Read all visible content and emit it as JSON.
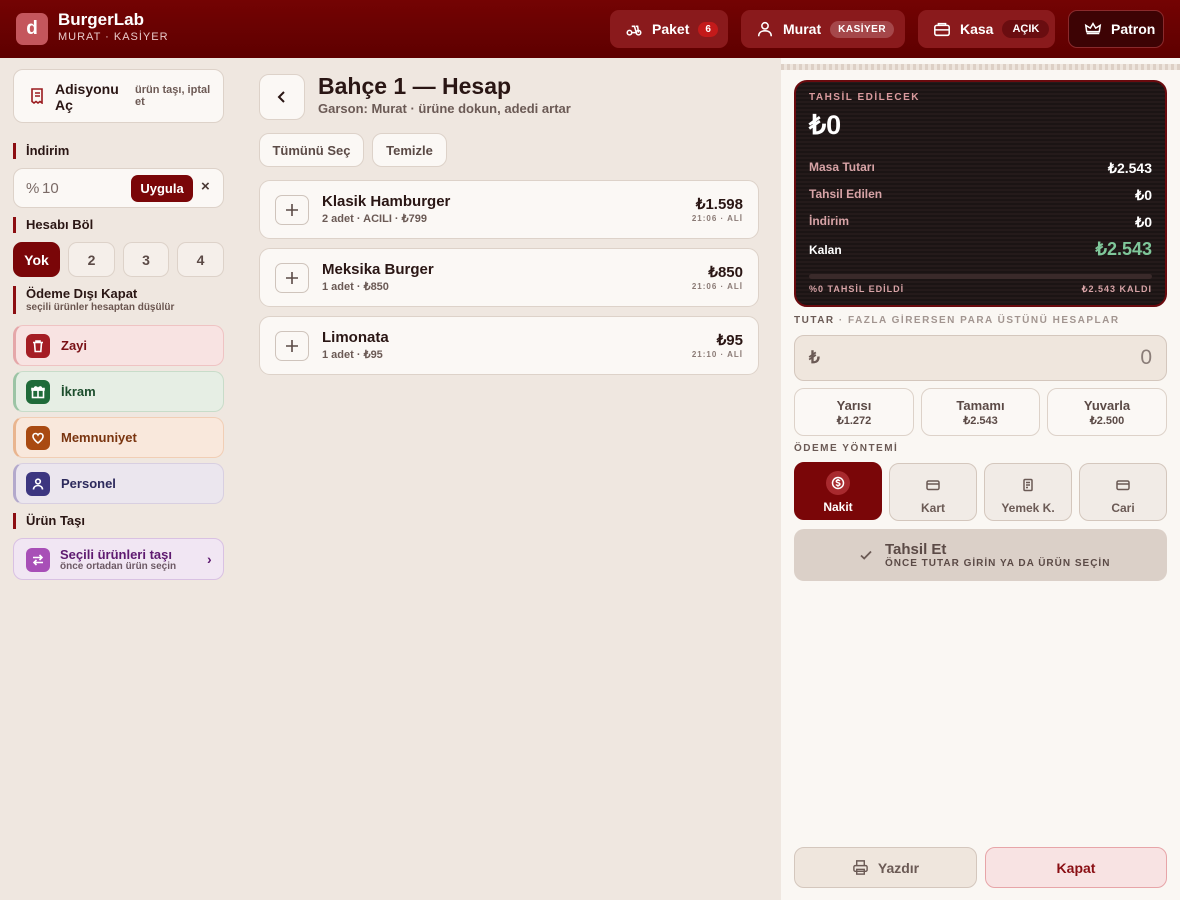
{
  "header": {
    "logo_letter": "d",
    "brand": "BurgerLab",
    "subtitle": "MURAT · KASİYER",
    "paket": {
      "label": "Paket",
      "count": "6"
    },
    "user": {
      "label": "Murat",
      "role": "KASİYER"
    },
    "kasa": {
      "label": "Kasa",
      "status": "AÇIK"
    },
    "patron": {
      "label": "Patron"
    }
  },
  "left": {
    "adisyon": {
      "label": "Adisyonu Aç",
      "sub": "ürün taşı, iptal et"
    },
    "discount": {
      "title": "İndirim",
      "prefix": "%",
      "value": "10",
      "apply": "Uygula",
      "clear": "×"
    },
    "split": {
      "title": "Hesabı Böl",
      "options": [
        "Yok",
        "2",
        "3",
        "4"
      ]
    },
    "off_payment": {
      "title": "Ödeme Dışı Kapat",
      "sub": "seçili ürünler hesaptan düşülür",
      "items": [
        {
          "label": "Zayi",
          "icon": "trash-icon"
        },
        {
          "label": "İkram",
          "icon": "gift-icon"
        },
        {
          "label": "Memnuniyet",
          "icon": "heart-icon"
        },
        {
          "label": "Personel",
          "icon": "person-icon"
        }
      ]
    },
    "move": {
      "title": "Ürün Taşı",
      "label": "Seçili ürünleri taşı",
      "sub": "önce ortadan ürün seçin",
      "chevron": "›"
    }
  },
  "main": {
    "title": "Bahçe 1 — Hesap",
    "subtitle": "Garson: Murat · ürüne dokun, adedi artar",
    "select_all": "Tümünü Seç",
    "clear": "Temizle",
    "items": [
      {
        "name": "Klasik Hamburger",
        "detail": "2 adet · ACILI · ₺799",
        "price": "₺1.598",
        "time": "21:06 · ALİ"
      },
      {
        "name": "Meksika Burger",
        "detail": "1 adet · ₺850",
        "price": "₺850",
        "time": "21:06 · ALİ"
      },
      {
        "name": "Limonata",
        "detail": "1 adet · ₺95",
        "price": "₺95",
        "time": "21:10 · ALİ"
      }
    ]
  },
  "right": {
    "card": {
      "label": "TAHSİL EDİLECEK",
      "amount": "₺0",
      "rows": [
        {
          "k": "Masa Tutarı",
          "v": "₺2.543"
        },
        {
          "k": "Tahsil Edilen",
          "v": "₺0"
        },
        {
          "k": "İndirim",
          "v": "₺0"
        },
        {
          "k": "Kalan",
          "v": "₺2.543"
        }
      ],
      "progress_fraction": 0,
      "footer_left": "%0 TAHSİL EDİLDİ",
      "footer_right": "₺2.543 KALDI"
    },
    "amount_caption": "TUTAR",
    "amount_hint": "· FAZLA GİRERSEN PARA ÜSTÜNÜ HESAPLAR",
    "amount_symbol": "₺",
    "amount_value": "0",
    "quick": [
      {
        "label": "Yarısı",
        "value": "₺1.272"
      },
      {
        "label": "Tamamı",
        "value": "₺2.543"
      },
      {
        "label": "Yuvarla",
        "value": "₺2.500"
      }
    ],
    "method_caption": "ÖDEME YÖNTEMİ",
    "methods": [
      "Nakit",
      "Kart",
      "Yemek K.",
      "Cari"
    ],
    "collect": {
      "label": "Tahsil Et",
      "sub": "ÖNCE TUTAR GİRİN YA DA ÜRÜN SEÇİN"
    },
    "print": "Yazdır",
    "close": "Kapat"
  },
  "colors": {
    "brand": "#6a0000",
    "accent_green": "#7fc79a"
  }
}
